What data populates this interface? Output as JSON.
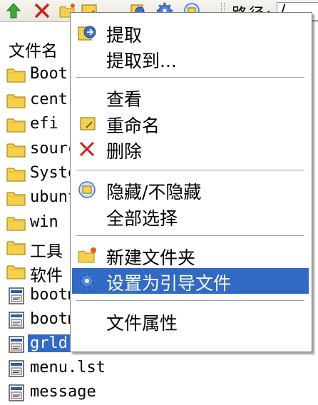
{
  "toolbar": {
    "icons": [
      "up-arrow-icon",
      "delete-x-icon",
      "new-folder-icon",
      "rename-icon",
      "extract-icon",
      "settings-gear-icon",
      "hide-toggle-icon"
    ],
    "path_label": "路径:",
    "path_value": "/"
  },
  "file_list": {
    "column_header": "文件名",
    "items": [
      {
        "name": "Boot",
        "type": "folder"
      },
      {
        "name": "cent",
        "type": "folder"
      },
      {
        "name": "efi",
        "type": "folder"
      },
      {
        "name": "sourc",
        "type": "folder"
      },
      {
        "name": "Syste",
        "type": "folder"
      },
      {
        "name": "ubunt",
        "type": "folder"
      },
      {
        "name": "win",
        "type": "folder"
      },
      {
        "name": "工具",
        "type": "folder"
      },
      {
        "name": "软件",
        "type": "folder"
      },
      {
        "name": "bootm",
        "type": "file"
      },
      {
        "name": "bootm",
        "type": "file"
      },
      {
        "name": "grldr",
        "type": "file",
        "selected": true
      },
      {
        "name": "menu.lst",
        "type": "file"
      },
      {
        "name": "message",
        "type": "file"
      }
    ]
  },
  "context_menu": {
    "items": [
      {
        "label": "提取",
        "icon": "extract-icon"
      },
      {
        "label": "提取到...",
        "icon": ""
      },
      {
        "label": "查看",
        "icon": ""
      },
      {
        "label": "重命名",
        "icon": "rename-icon"
      },
      {
        "label": "删除",
        "icon": "delete-x-icon"
      },
      {
        "label": "隐藏/不隐藏",
        "icon": "hide-toggle-icon"
      },
      {
        "label": "全部选择",
        "icon": ""
      },
      {
        "label": "新建文件夹",
        "icon": "new-folder-icon"
      },
      {
        "label": "设置为引导文件",
        "icon": "settings-gear-icon",
        "highlighted": true
      },
      {
        "label": "文件属性",
        "icon": ""
      }
    ]
  },
  "colors": {
    "highlight": "#316ac5",
    "folder": "#f5d04a",
    "delete": "#d21e1e"
  }
}
